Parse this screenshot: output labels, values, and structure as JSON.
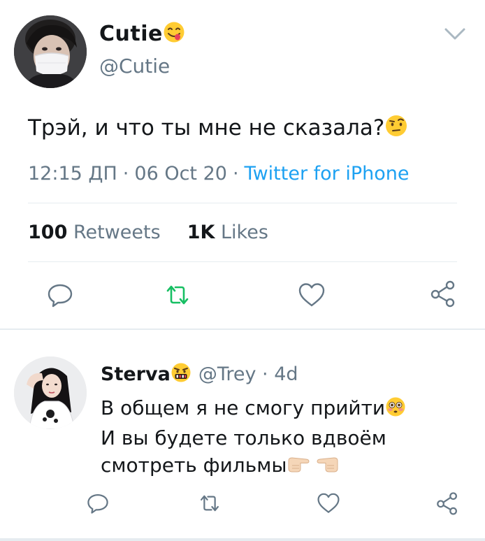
{
  "tweet": {
    "author_name": "Cutie",
    "author_emoji": "savoring-food-face-emoji",
    "author_handle": "@Cutie",
    "text": "Трэй, и что ты мне не сказала?",
    "text_emoji": "face-with-raised-eyebrow-emoji",
    "time": "12:15 ДП",
    "date": "06 Oct 20",
    "separator": "·",
    "source": "Twitter for iPhone",
    "retweets_count": "100",
    "retweets_label": "Retweets",
    "likes_count": "1K",
    "likes_label": "Likes"
  },
  "reply": {
    "author_name": "Sterva",
    "author_emoji": "face-with-symbols-on-mouth-emoji",
    "handle": "@Trey",
    "separator": "·",
    "age": "4d",
    "lines": [
      "В общем я не смогу прийти",
      "И вы будете только вдвоём",
      "смотреть фильмы"
    ],
    "line1_emoji": "flushed-face-emoji",
    "line3_emoji": "pointing-fingers-emoji"
  },
  "icons": {
    "reply": "comment-icon",
    "retweet": "retweet-icon",
    "like": "heart-icon",
    "share": "share-icon",
    "menu": "chevron-down-icon"
  },
  "colors": {
    "text": "#14171a",
    "secondary": "#657786",
    "link": "#1da1f2",
    "retweet_green": "#17bf63",
    "divider": "#e6ecf0"
  }
}
